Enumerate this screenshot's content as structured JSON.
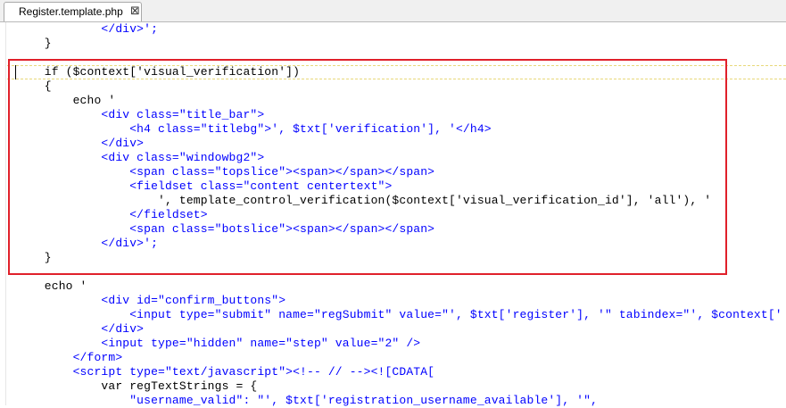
{
  "tab": {
    "title": "Register.template.php",
    "close_symbol": "⊠"
  },
  "code": [
    {
      "text": "            </div>';",
      "color": "html"
    },
    {
      "text": "    }",
      "color": "php"
    },
    {
      "text": "",
      "color": "php"
    },
    {
      "text": "    if ($context['visual_verification'])",
      "color": "php"
    },
    {
      "text": "    {",
      "color": "php"
    },
    {
      "text": "        echo '",
      "color": "php"
    },
    {
      "text": "            <div class=\"title_bar\">",
      "color": "html"
    },
    {
      "text": "                <h4 class=\"titlebg\">', $txt['verification'], '</h4>",
      "color": "html"
    },
    {
      "text": "            </div>",
      "color": "html"
    },
    {
      "text": "            <div class=\"windowbg2\">",
      "color": "html"
    },
    {
      "text": "                <span class=\"topslice\"><span></span></span>",
      "color": "html"
    },
    {
      "text": "                <fieldset class=\"content centertext\">",
      "color": "html"
    },
    {
      "text": "                    ', template_control_verification($context['visual_verification_id'], 'all'), '",
      "color": "php"
    },
    {
      "text": "                </fieldset>",
      "color": "html"
    },
    {
      "text": "                <span class=\"botslice\"><span></span></span>",
      "color": "html"
    },
    {
      "text": "            </div>';",
      "color": "html"
    },
    {
      "text": "    }",
      "color": "php"
    },
    {
      "text": "",
      "color": "php"
    },
    {
      "text": "    echo '",
      "color": "php"
    },
    {
      "text": "            <div id=\"confirm_buttons\">",
      "color": "html"
    },
    {
      "text": "                <input type=\"submit\" name=\"regSubmit\" value=\"', $txt['register'], '\" tabindex=\"', $context['",
      "color": "html"
    },
    {
      "text": "            </div>",
      "color": "html"
    },
    {
      "text": "            <input type=\"hidden\" name=\"step\" value=\"2\" />",
      "color": "html"
    },
    {
      "text": "        </form>",
      "color": "html"
    },
    {
      "text": "        <script type=\"text/javascript\"><!-- // --><![CDATA[",
      "color": "html"
    },
    {
      "text": "            var regTextStrings = {",
      "color": "php"
    },
    {
      "text": "                \"username_valid\": \"', $txt['registration_username_available'], '\",",
      "color": "html"
    }
  ]
}
